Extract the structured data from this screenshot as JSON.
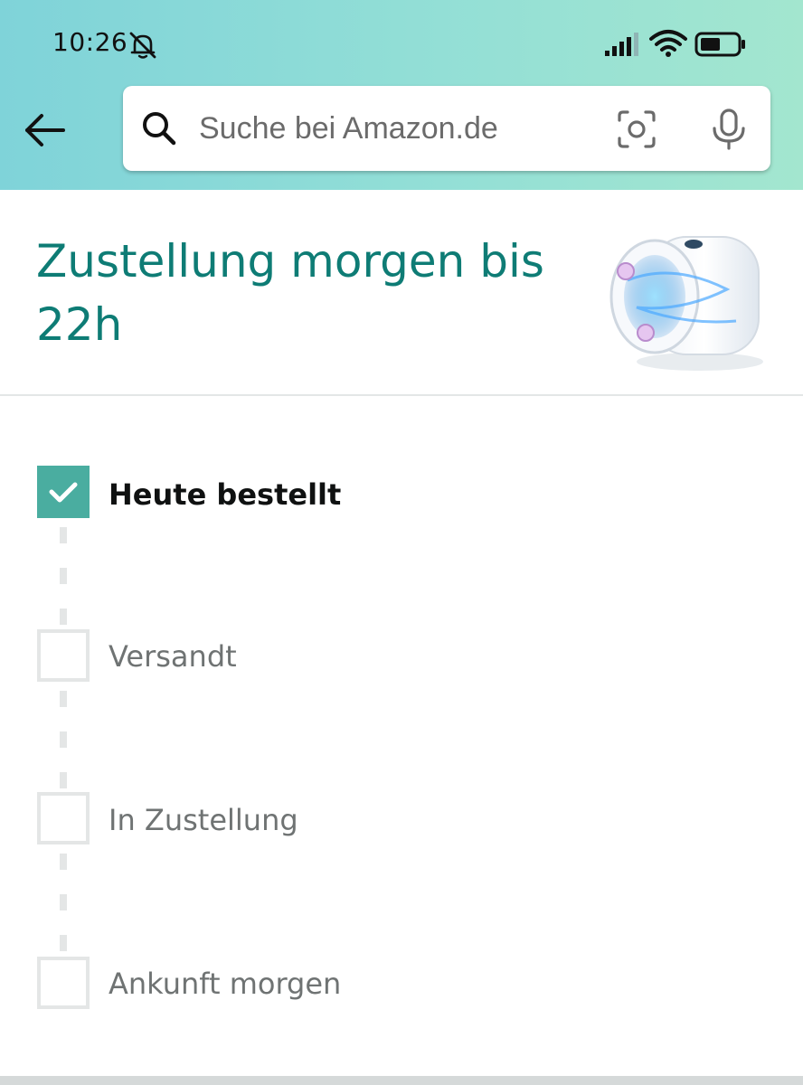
{
  "status_bar": {
    "time": "10:26",
    "icons": [
      "bell-off-icon",
      "cellular-signal-icon",
      "wifi-icon",
      "battery-icon"
    ]
  },
  "header": {
    "back_icon": "back-arrow-icon",
    "search": {
      "placeholder": "Suche bei Amazon.de",
      "value": "",
      "icons": [
        "search-icon",
        "camera-scan-icon",
        "microphone-icon"
      ]
    },
    "gradient_colors": [
      "#7fd3d9",
      "#a3e6cf"
    ]
  },
  "delivery": {
    "title": "Zustellung morgen bis 22h",
    "title_color": "#0e7c75",
    "product_image": "product-thumbnail"
  },
  "timeline": {
    "steps": [
      {
        "label": "Heute bestellt",
        "completed": true
      },
      {
        "label": "Versandt",
        "completed": false
      },
      {
        "label": "In Zustellung",
        "completed": false
      },
      {
        "label": "Ankunft morgen",
        "completed": false
      }
    ],
    "completed_color": "#4aada0",
    "pending_color": "#e4e6e6"
  }
}
